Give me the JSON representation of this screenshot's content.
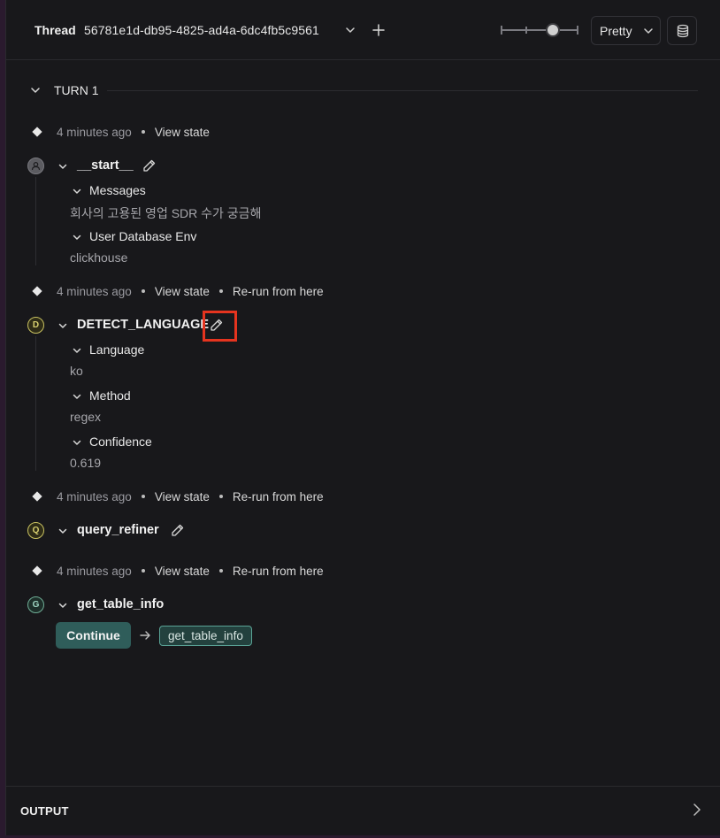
{
  "header": {
    "thread_label": "Thread",
    "thread_id": "56781e1d-db95-4825-ad4a-6dc4fb5c9561",
    "view_mode": "Pretty"
  },
  "turn": {
    "title": "TURN 1"
  },
  "meta_rows": [
    {
      "time": "4 minutes ago",
      "view_state": "View state",
      "rerun": ""
    },
    {
      "time": "4 minutes ago",
      "view_state": "View state",
      "rerun": "Re-run from here"
    },
    {
      "time": "4 minutes ago",
      "view_state": "View state",
      "rerun": "Re-run from here"
    },
    {
      "time": "4 minutes ago",
      "view_state": "View state",
      "rerun": "Re-run from here"
    }
  ],
  "nodes": [
    {
      "name": "__start__",
      "avatar": "",
      "avatar_color": "#5b5b60",
      "fields": [
        {
          "name": "Messages",
          "value": "회사의 고용된 영업 SDR 수가 궁금해"
        },
        {
          "name": "User Database Env",
          "value": "clickhouse"
        }
      ]
    },
    {
      "name": "DETECT_LANGUAGE",
      "avatar": "D",
      "avatar_color": "#c9c260",
      "fields": [
        {
          "name": "Language",
          "value": "ko"
        },
        {
          "name": "Method",
          "value": "regex"
        },
        {
          "name": "Confidence",
          "value": "0.619"
        }
      ]
    },
    {
      "name": "query_refiner",
      "avatar": "Q",
      "avatar_color": "#c9c260",
      "fields": []
    },
    {
      "name": "get_table_info",
      "avatar": "G",
      "avatar_color": "#6fae96",
      "fields": []
    }
  ],
  "interrupt": {
    "continue_label": "Continue",
    "next_node": "get_table_info"
  },
  "output": {
    "label": "OUTPUT"
  },
  "colors": {
    "accent": "#2f5d5a",
    "highlight": "#e5341f",
    "background": "#18181b"
  }
}
